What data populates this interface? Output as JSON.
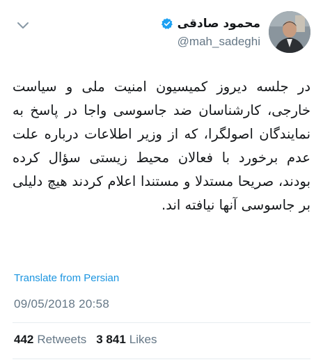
{
  "author": {
    "display_name": "محمود صادقی",
    "handle": "@mah_sadeghi",
    "verified": true,
    "avatar_icon": "profile-photo",
    "menu_icon": "chevron-down-icon"
  },
  "tweet": {
    "text": "در جلسه دیروز کمیسیون امنیت ملی و سیاست خارجی، کارشناسان ضد جاسوسی واجا در پاسخ به نمایندگان اصولگرا، که از وزیر اطلاعات درباره علت عدم برخورد با فعالان محیط زیستی سؤال کرده بودند، صریحا مستدلا و مستندا اعلام کردند هیچ دلیلی بر جاسوسی آنها نیافته اند.",
    "translate_label": "Translate from Persian",
    "timestamp": "09/05/2018 20:58"
  },
  "stats": {
    "retweets_count": "442",
    "retweets_label": "Retweets",
    "likes_count": "3 841",
    "likes_label": "Likes"
  },
  "colors": {
    "link": "#1b95e0",
    "muted": "#657786",
    "text": "#14171a",
    "verified": "#1da1f2",
    "divider": "#e6ecf0"
  }
}
